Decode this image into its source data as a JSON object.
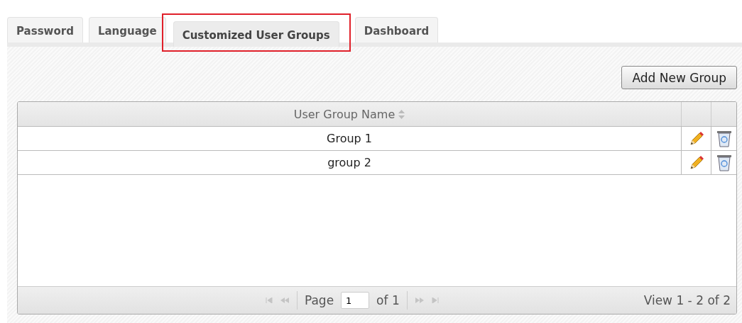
{
  "tabs": [
    {
      "label": "Password",
      "selected": false
    },
    {
      "label": "Language",
      "selected": false
    },
    {
      "label": "Customized User Groups",
      "selected": true,
      "highlighted": true
    },
    {
      "label": "Dashboard",
      "selected": false
    }
  ],
  "add_button": "Add New Group",
  "table": {
    "columns": [
      {
        "label": "User Group Name",
        "sortable": true
      }
    ],
    "rows": [
      {
        "name": "Group 1"
      },
      {
        "name": "group 2"
      }
    ]
  },
  "pager": {
    "page_label": "Page",
    "page": "1",
    "of_label": "of 1",
    "first_disabled": true,
    "prev_disabled": true,
    "next_disabled": true,
    "last_disabled": true,
    "view": "View 1 - 2 of 2"
  }
}
